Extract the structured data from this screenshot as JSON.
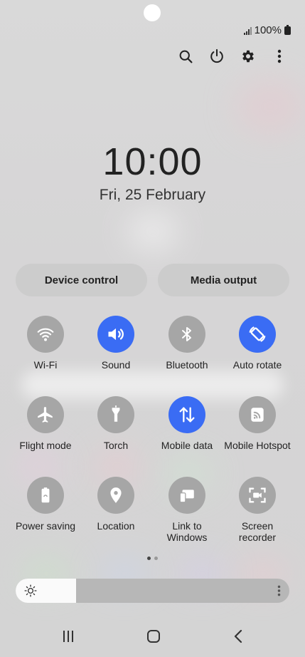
{
  "status_bar": {
    "battery": "100%",
    "signal_icon": "signal-icon",
    "battery_icon": "battery-icon"
  },
  "top_actions": {
    "search_icon": "search-icon",
    "power_icon": "power-icon",
    "settings_icon": "gear-icon",
    "more_icon": "more-vertical-icon"
  },
  "clock": {
    "time": "10:00",
    "date": "Fri, 25 February"
  },
  "quick_buttons": {
    "device_control": "Device control",
    "media_output": "Media output"
  },
  "tiles": [
    {
      "label": "Wi-Fi",
      "icon": "wifi-icon",
      "active": false
    },
    {
      "label": "Sound",
      "icon": "sound-icon",
      "active": true
    },
    {
      "label": "Bluetooth",
      "icon": "bluetooth-icon",
      "active": false
    },
    {
      "label": "Auto rotate",
      "icon": "auto-rotate-icon",
      "active": true
    },
    {
      "label": "Flight mode",
      "icon": "airplane-icon",
      "active": false
    },
    {
      "label": "Torch",
      "icon": "torch-icon",
      "active": false
    },
    {
      "label": "Mobile data",
      "icon": "mobile-data-icon",
      "active": true
    },
    {
      "label": "Mobile Hotspot",
      "icon": "hotspot-icon",
      "active": false
    },
    {
      "label": "Power saving",
      "icon": "power-saving-icon",
      "active": false
    },
    {
      "label": "Location",
      "icon": "location-icon",
      "active": false
    },
    {
      "label": "Link to Windows",
      "icon": "link-windows-icon",
      "active": false
    },
    {
      "label": "Screen recorder",
      "icon": "screen-recorder-icon",
      "active": false
    }
  ],
  "pager": {
    "pages": 2,
    "current": 1
  },
  "brightness": {
    "level": 0.22,
    "icon": "brightness-icon",
    "more_icon": "more-vertical-icon"
  },
  "colors": {
    "active": "#3a6cf4",
    "inactive": "#a6a6a6"
  },
  "nav": {
    "recents_icon": "recents-icon",
    "home_icon": "home-icon",
    "back_icon": "back-icon"
  }
}
